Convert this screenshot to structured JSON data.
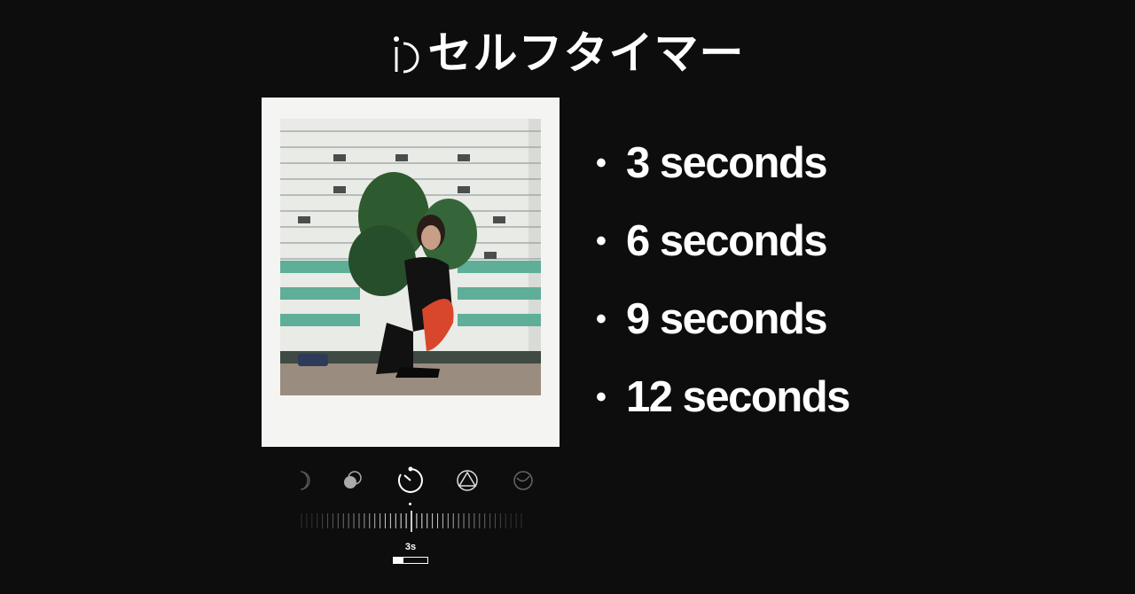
{
  "header": {
    "title": "セルフタイマー",
    "icon": "self-timer-icon"
  },
  "photo": {
    "description_icon": "polaroid-photo"
  },
  "timer_options": [
    {
      "bullet": "•",
      "label": "3 seconds"
    },
    {
      "bullet": "•",
      "label": "6 seconds"
    },
    {
      "bullet": "•",
      "label": "9 seconds"
    },
    {
      "bullet": "•",
      "label": "12 seconds"
    }
  ],
  "toolbar": {
    "tools": [
      "moon-icon",
      "double-exposure-icon",
      "self-timer-icon",
      "aperture-triangle-icon",
      "lens-icon"
    ],
    "selected": "self-timer-icon"
  },
  "timer_control": {
    "value_label": "3s",
    "progress": 0.3
  },
  "colors": {
    "background": "#0d0d0d",
    "text": "#ffffff",
    "frame": "#f4f4f2"
  }
}
